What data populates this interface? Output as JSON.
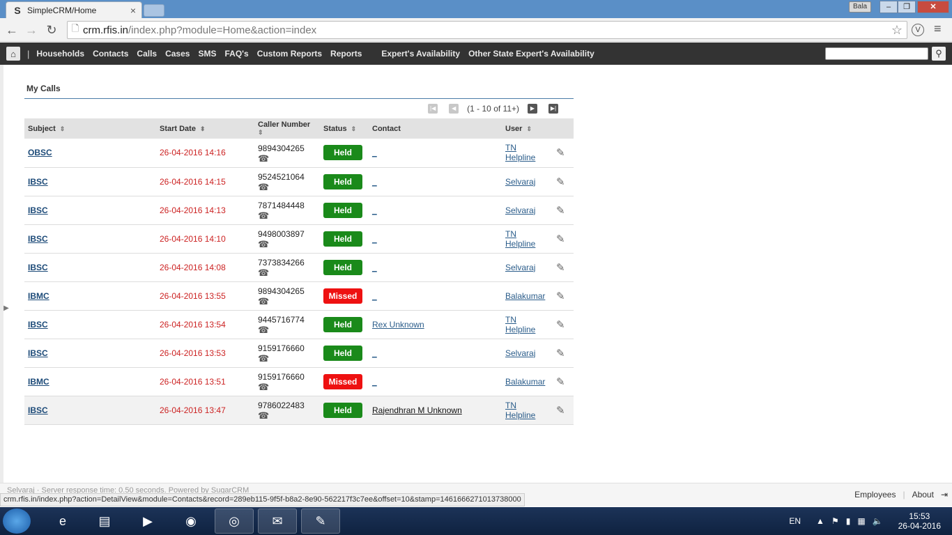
{
  "browser": {
    "tab_title": "SimpleCRM/Home",
    "tab_favicon": "S",
    "tab_close": "×",
    "profile": "Bala",
    "url_host": "crm.rfis.in",
    "url_path": "/index.php?module=Home&action=index"
  },
  "nav": {
    "items": [
      "Households",
      "Contacts",
      "Calls",
      "Cases",
      "SMS",
      "FAQ's",
      "Custom Reports",
      "Reports"
    ],
    "extra_items": [
      "Expert's Availability",
      "Other State Expert's Availability"
    ]
  },
  "dashlet": {
    "title": "My Calls",
    "pager_text": "(1 - 10 of 11+)",
    "columns": {
      "subject": "Subject",
      "start_date": "Start Date",
      "caller_number": "Caller Number",
      "status": "Status",
      "contact": "Contact",
      "user": "User"
    },
    "rows": [
      {
        "subject": "OBSC",
        "start_date": "26-04-2016 14:16",
        "caller": "9894304265",
        "status": "Held",
        "contact": "_",
        "user": "TN Helpline"
      },
      {
        "subject": "IBSC",
        "start_date": "26-04-2016 14:15",
        "caller": "9524521064",
        "status": "Held",
        "contact": "_",
        "user": "Selvaraj"
      },
      {
        "subject": "IBSC",
        "start_date": "26-04-2016 14:13",
        "caller": "7871484448",
        "status": "Held",
        "contact": "_",
        "user": "Selvaraj"
      },
      {
        "subject": "IBSC",
        "start_date": "26-04-2016 14:10",
        "caller": "9498003897",
        "status": "Held",
        "contact": "_",
        "user": "TN Helpline"
      },
      {
        "subject": "IBSC",
        "start_date": "26-04-2016 14:08",
        "caller": "7373834266",
        "status": "Held",
        "contact": "_",
        "user": "Selvaraj"
      },
      {
        "subject": "IBMC",
        "start_date": "26-04-2016 13:55",
        "caller": "9894304265",
        "status": "Missed",
        "contact": "_",
        "user": "Balakumar"
      },
      {
        "subject": "IBSC",
        "start_date": "26-04-2016 13:54",
        "caller": "9445716774",
        "status": "Held",
        "contact": "Rex Unknown",
        "user": "TN Helpline"
      },
      {
        "subject": "IBSC",
        "start_date": "26-04-2016 13:53",
        "caller": "9159176660",
        "status": "Held",
        "contact": "_",
        "user": "Selvaraj"
      },
      {
        "subject": "IBMC",
        "start_date": "26-04-2016 13:51",
        "caller": "9159176660",
        "status": "Missed",
        "contact": "_",
        "user": "Balakumar"
      },
      {
        "subject": "IBSC",
        "start_date": "26-04-2016 13:47",
        "caller": "9786022483",
        "status": "Held",
        "contact": "Rajendhran M Unknown",
        "user": "TN Helpline"
      }
    ]
  },
  "footer": {
    "ghost_text": "Selvaraj   ·   Server response time: 0.50 seconds.   Powered by SugarCRM",
    "employees": "Employees",
    "about": "About",
    "status_url": "crm.rfis.in/index.php?action=DetailView&module=Contacts&record=289eb115-9f5f-b8a2-8e90-562217f3c7ee&offset=10&stamp=1461666271013738000"
  },
  "taskbar": {
    "lang": "EN",
    "time": "15:53",
    "date": "26-04-2016"
  },
  "colors": {
    "held": "#1a8a1a",
    "missed": "#ee1111",
    "nav_bg": "#333333",
    "date_red": "#cc2222",
    "link_blue": "#1c4a78"
  }
}
